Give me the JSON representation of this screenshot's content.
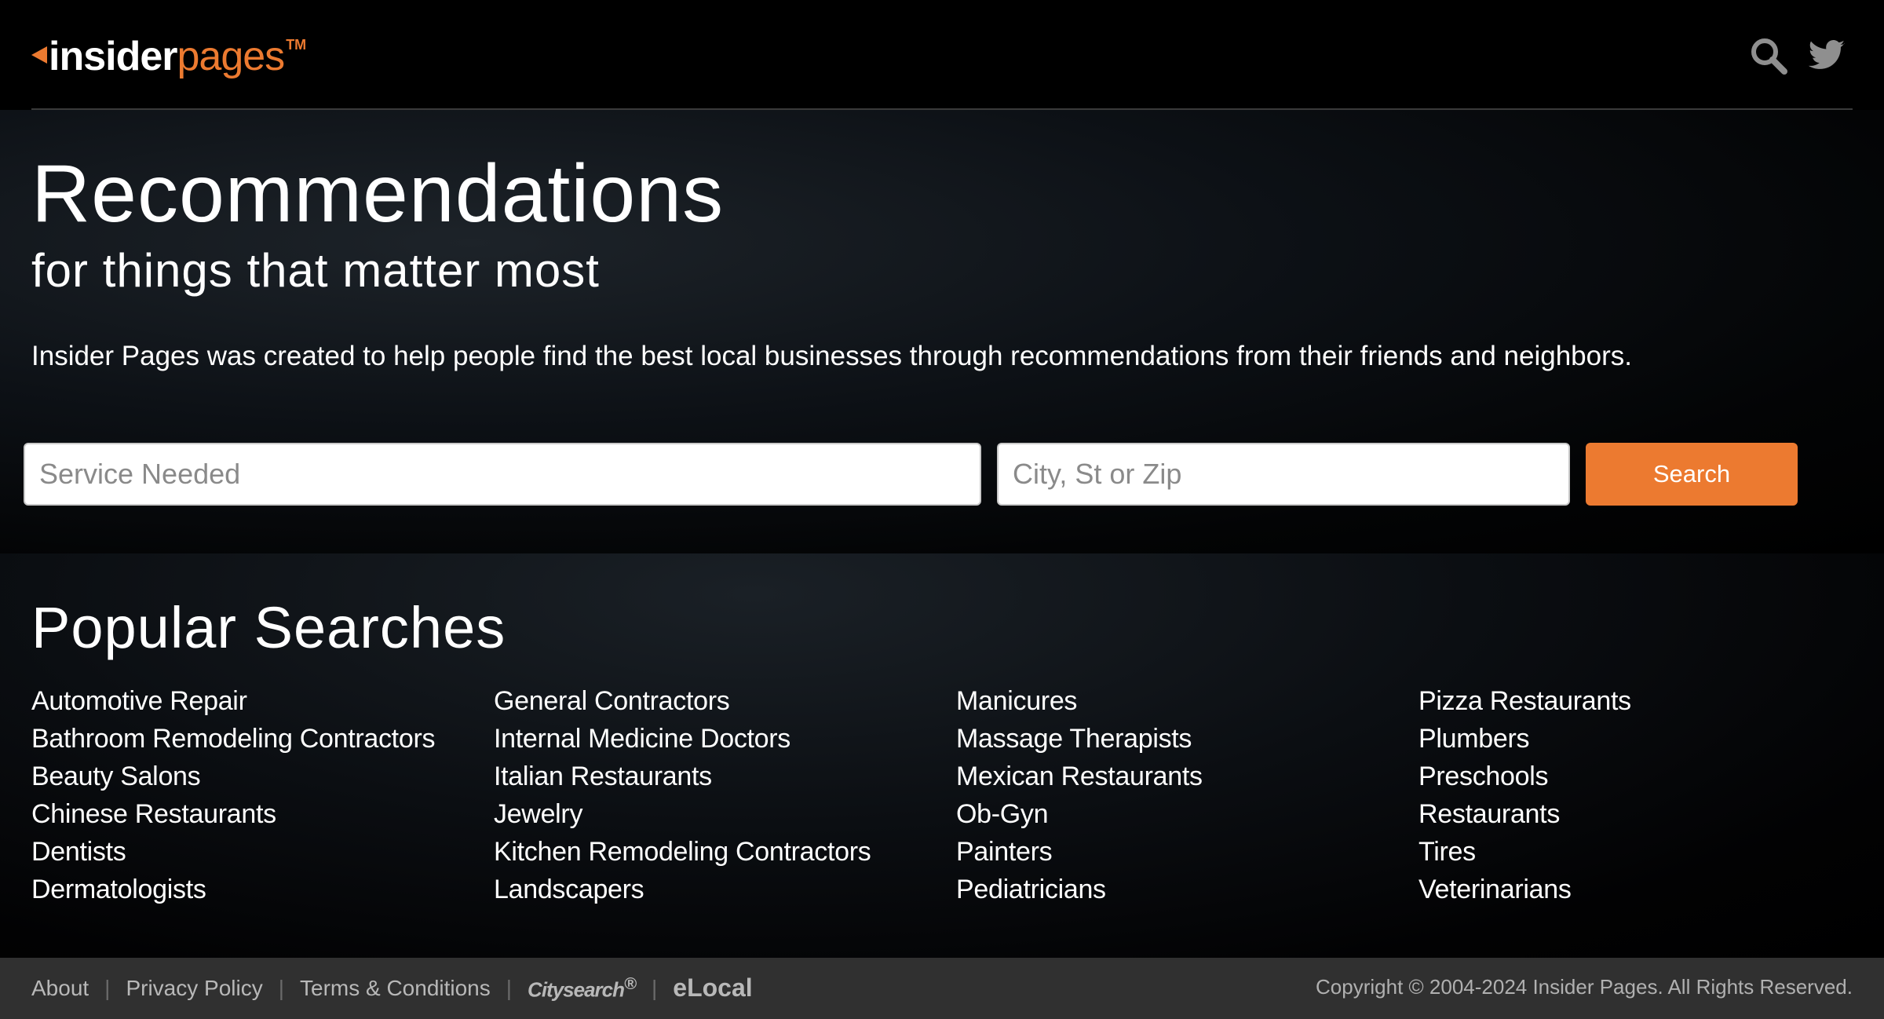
{
  "header": {
    "logo_insider": "insider",
    "logo_pages": "pages",
    "logo_tm": "TM",
    "icons": [
      "search-icon",
      "twitter-icon"
    ]
  },
  "hero": {
    "title": "Recommendations",
    "subtitle": "for things that matter most",
    "description": "Insider Pages was created to help people find the best local businesses through recommendations from their friends and neighbors."
  },
  "search": {
    "service_placeholder": "Service Needed",
    "location_placeholder": "City, St or Zip",
    "button_label": "Search"
  },
  "popular": {
    "title": "Popular Searches",
    "columns": [
      [
        "Automotive Repair",
        "Bathroom Remodeling Contractors",
        "Beauty Salons",
        "Chinese Restaurants",
        "Dentists",
        "Dermatologists"
      ],
      [
        "General Contractors",
        "Internal Medicine Doctors",
        "Italian Restaurants",
        "Jewelry",
        "Kitchen Remodeling Contractors",
        "Landscapers"
      ],
      [
        "Manicures",
        "Massage Therapists",
        "Mexican Restaurants",
        "Ob-Gyn",
        "Painters",
        "Pediatricians"
      ],
      [
        "Pizza Restaurants",
        "Plumbers",
        "Preschools",
        "Restaurants",
        "Tires",
        "Veterinarians"
      ]
    ]
  },
  "footer": {
    "links": [
      "About",
      "Privacy Policy",
      "Terms & Conditions"
    ],
    "citysearch": "Citysearch",
    "citysearch_mark": "®",
    "elocal": "eLocal",
    "copyright": "Copyright © 2004-2024 Insider Pages. All Rights Reserved."
  },
  "colors": {
    "accent": "#ec7a30",
    "background": "#000000",
    "footer_bg": "#303030"
  }
}
